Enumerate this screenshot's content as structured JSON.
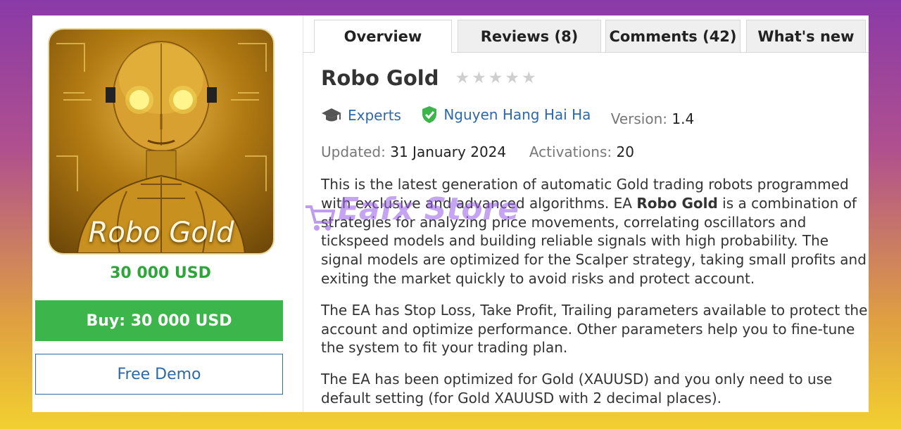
{
  "product": {
    "image_caption": "Robo Gold",
    "price": "30 000 USD",
    "buy_label": "Buy: 30 000 USD",
    "demo_label": "Free Demo"
  },
  "tabs": [
    {
      "label": "Overview",
      "active": true
    },
    {
      "label": "Reviews (8)",
      "active": false
    },
    {
      "label": "Comments (42)",
      "active": false
    },
    {
      "label": "What's new",
      "active": false
    }
  ],
  "header": {
    "title": "Robo Gold",
    "rating": 0,
    "category": "Experts",
    "author": "Nguyen Hang Hai Ha",
    "version_label": "Version:",
    "version": "1.4",
    "updated_label": "Updated:",
    "updated": "31 January 2024",
    "activations_label": "Activations:",
    "activations": "20"
  },
  "description": {
    "p1_before": "This is the latest generation of automatic Gold trading robots programmed with exclusive and advanced algorithms. EA ",
    "p1_bold": "Robo Gold",
    "p1_after": " is a combination of strategies for analyzing price movements, correlating oscillators and tickspeed models and building reliable signals with high probability. The signal models are optimized for the Scalper strategy, taking small profits and exiting the market quickly to avoid risks and protect account.",
    "p2": "The EA has Stop Loss, Take Profit, Trailing parameters available to protect the account and optimize performance. Other parameters help you to fine-tune the system to fit your trading plan.",
    "p3": "The EA has been optimized for Gold (XAUUSD) and you only need to use default setting (for Gold XAUUSD with 2 decimal places)."
  },
  "watermark": "Eafx Store",
  "colors": {
    "accent_green": "#3cb54a",
    "link_blue": "#2e68a8"
  }
}
